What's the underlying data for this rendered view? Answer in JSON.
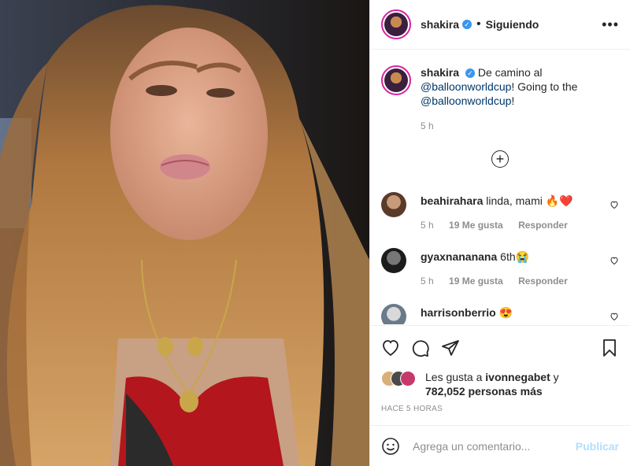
{
  "header": {
    "username": "shakira",
    "verified_icon": "verified-badge-icon",
    "separator": "•",
    "follow_status": "Siguiendo",
    "more_label": "•••"
  },
  "caption": {
    "username": "shakira",
    "text_1": "De camino al",
    "mention_1": "@balloonworldcup",
    "text_2": "! Going to the",
    "mention_2": "@balloonworldcup",
    "text_3": "!",
    "time": "5 h"
  },
  "load_more_label": "+",
  "comments": [
    {
      "username": "beahirahara",
      "text": "linda, mami 🔥❤️",
      "time": "5 h",
      "likes": "19 Me gusta",
      "reply": "Responder"
    },
    {
      "username": "gyaxnananana",
      "text": "6th😭",
      "time": "5 h",
      "likes": "19 Me gusta",
      "reply": "Responder"
    },
    {
      "username": "harrisonberrio",
      "text": "😍"
    }
  ],
  "likes": {
    "prefix": "Les gusta a",
    "user": "ivonnegabet",
    "conj": "y",
    "count": "782,052 personas más"
  },
  "posted_ago": "HACE 5 HORAS",
  "add_comment": {
    "emoji_icon": "emoji-icon",
    "placeholder": "Agrega un comentario...",
    "publish_label": "Publicar"
  },
  "colors": {
    "accent": "#3897f0",
    "publish_disabled": "#b2dffc",
    "link": "#00376b",
    "muted": "#8e8e8e"
  }
}
